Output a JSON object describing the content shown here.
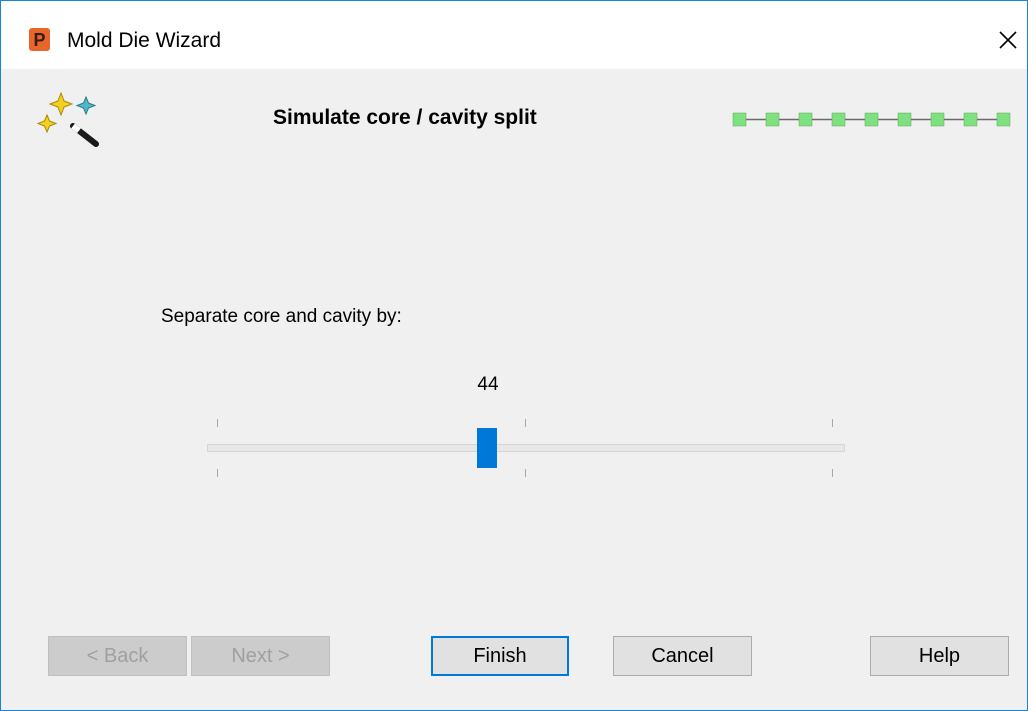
{
  "window": {
    "title": "Mold Die Wizard",
    "app_icon": "powermill-p-icon",
    "close_icon": "close-icon"
  },
  "wizard": {
    "icon": "magic-wand-sparkles-icon",
    "title": "Simulate core / cavity split",
    "progress": {
      "total_steps": 9,
      "completed_steps": 9,
      "step_color": "#7ee07e"
    }
  },
  "slider": {
    "label": "Separate core and cavity by:",
    "value": "44",
    "accent_color": "#0078d7"
  },
  "buttons": {
    "back": "< Back",
    "next": "Next >",
    "finish": "Finish",
    "cancel": "Cancel",
    "help": "Help"
  }
}
